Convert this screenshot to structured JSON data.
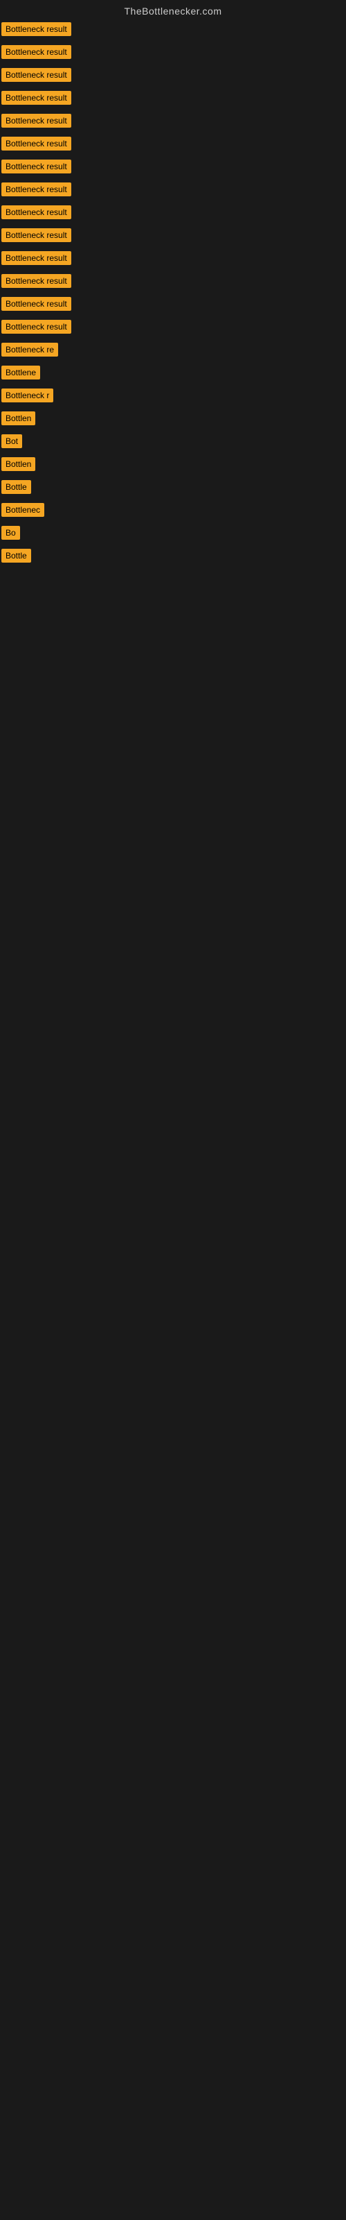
{
  "header": {
    "title": "TheBottlenecker.com"
  },
  "items": [
    {
      "label": "Bottleneck result",
      "width": 130
    },
    {
      "label": "Bottleneck result",
      "width": 130
    },
    {
      "label": "Bottleneck result",
      "width": 130
    },
    {
      "label": "Bottleneck result",
      "width": 130
    },
    {
      "label": "Bottleneck result",
      "width": 130
    },
    {
      "label": "Bottleneck result",
      "width": 130
    },
    {
      "label": "Bottleneck result",
      "width": 130
    },
    {
      "label": "Bottleneck result",
      "width": 130
    },
    {
      "label": "Bottleneck result",
      "width": 130
    },
    {
      "label": "Bottleneck result",
      "width": 130
    },
    {
      "label": "Bottleneck result",
      "width": 130
    },
    {
      "label": "Bottleneck result",
      "width": 130
    },
    {
      "label": "Bottleneck result",
      "width": 130
    },
    {
      "label": "Bottleneck result",
      "width": 130
    },
    {
      "label": "Bottleneck re",
      "width": 100
    },
    {
      "label": "Bottlene",
      "width": 78
    },
    {
      "label": "Bottleneck r",
      "width": 90
    },
    {
      "label": "Bottlen",
      "width": 68
    },
    {
      "label": "Bot",
      "width": 35
    },
    {
      "label": "Bottlen",
      "width": 68
    },
    {
      "label": "Bottle",
      "width": 58
    },
    {
      "label": "Bottlenec",
      "width": 82
    },
    {
      "label": "Bo",
      "width": 28
    },
    {
      "label": "Bottle",
      "width": 58
    }
  ],
  "colors": {
    "label_bg": "#f5a623",
    "label_text": "#000000",
    "background": "#1a1a1a",
    "header_text": "#cccccc"
  }
}
